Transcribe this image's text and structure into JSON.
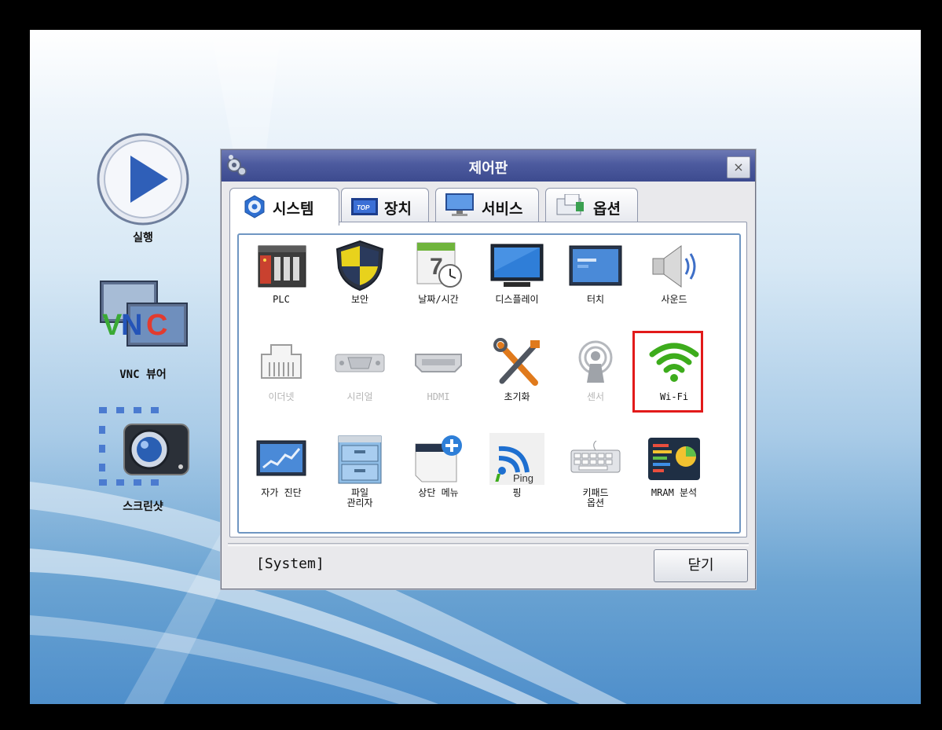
{
  "desktop": {
    "items": [
      {
        "label": "실행"
      },
      {
        "label": "VNC 뷰어"
      },
      {
        "label": "스크린샷"
      }
    ]
  },
  "dialog": {
    "title": "제어판",
    "close_icon": "×",
    "tabs": [
      {
        "label": "시스템",
        "icon": "gear-icon",
        "active": true
      },
      {
        "label": "장치",
        "icon": "top-device-icon"
      },
      {
        "label": "서비스",
        "icon": "monitor-service-icon"
      },
      {
        "label": "옵션",
        "icon": "option-icon"
      }
    ],
    "items": [
      {
        "label": "PLC",
        "icon": "plc-icon",
        "enabled": true
      },
      {
        "label": "보안",
        "icon": "shield-icon",
        "enabled": true
      },
      {
        "label": "날짜/시간",
        "icon": "calendar-clock-icon",
        "enabled": true,
        "calendar_day": "7"
      },
      {
        "label": "디스플레이",
        "icon": "monitor-icon",
        "enabled": true
      },
      {
        "label": "터치",
        "icon": "touch-panel-icon",
        "enabled": true
      },
      {
        "label": "사운드",
        "icon": "speaker-icon",
        "enabled": true
      },
      {
        "label": "이더넷",
        "icon": "ethernet-port-icon",
        "enabled": false
      },
      {
        "label": "시리얼",
        "icon": "serial-port-icon",
        "enabled": false
      },
      {
        "label": "HDMI",
        "icon": "hdmi-port-icon",
        "enabled": false
      },
      {
        "label": "초기화",
        "icon": "tools-icon",
        "enabled": true
      },
      {
        "label": "센서",
        "icon": "sensor-icon",
        "enabled": false
      },
      {
        "label": "Wi-Fi",
        "icon": "wifi-icon",
        "enabled": true,
        "highlighted": true
      },
      {
        "label": "자가 진단",
        "icon": "diagnostic-chart-icon",
        "enabled": true
      },
      {
        "label": "파일\n관리자",
        "icon": "file-cabinet-icon",
        "enabled": true
      },
      {
        "label": "상단 메뉴",
        "icon": "top-menu-add-icon",
        "enabled": true
      },
      {
        "label": "핑",
        "icon": "ping-icon",
        "enabled": true,
        "badge": "Ping"
      },
      {
        "label": "키패드\n옵션",
        "icon": "keyboard-icon",
        "enabled": true
      },
      {
        "label": "MRAM 분석",
        "icon": "mram-analysis-icon",
        "enabled": true
      }
    ],
    "status": "[System]",
    "close_button": "닫기"
  },
  "colors": {
    "titlebar": "#4c5a9e",
    "highlight": "#e21a1a",
    "wifi": "#3dac1c",
    "panel_border": "#6f96c2"
  }
}
